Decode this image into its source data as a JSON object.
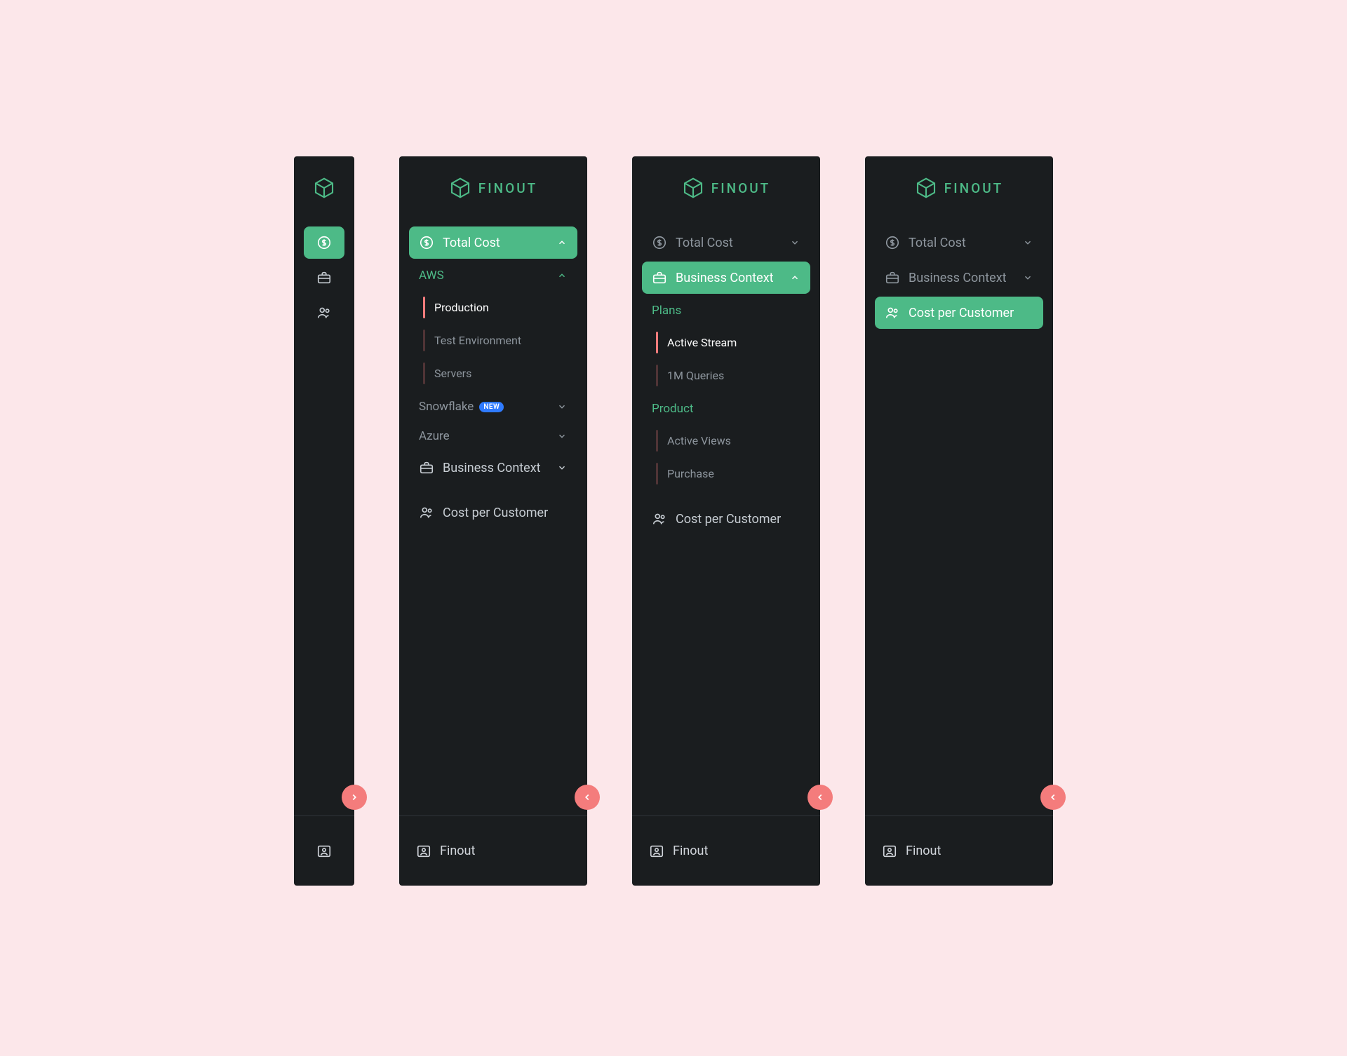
{
  "brand": "FINOUT",
  "nav": {
    "total_cost": "Total Cost",
    "business_context": "Business Context",
    "cost_per_customer": "Cost per Customer"
  },
  "panel2": {
    "groups": {
      "aws": {
        "label": "AWS",
        "items": [
          "Production",
          "Test Environment",
          "Servers"
        ],
        "active_index": 0
      },
      "snowflake": {
        "label": "Snowflake",
        "badge": "NEW"
      },
      "azure": {
        "label": "Azure"
      }
    }
  },
  "panel3": {
    "groups": {
      "plans": {
        "label": "Plans",
        "items": [
          "Active Stream",
          "1M Queries"
        ],
        "active_index": 0
      },
      "product": {
        "label": "Product",
        "items": [
          "Active Views",
          "Purchase"
        ],
        "active_index": -1
      }
    }
  },
  "footer": {
    "user": "Finout"
  }
}
